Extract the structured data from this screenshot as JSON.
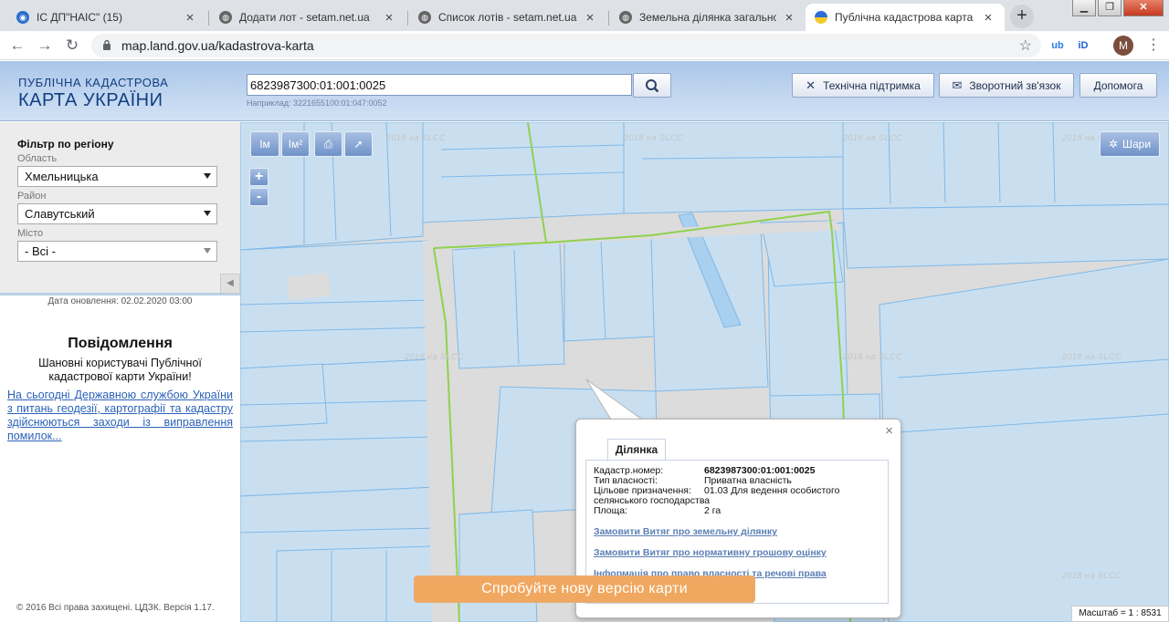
{
  "browser": {
    "tabs": [
      {
        "title": "ІС ДП\"НАІС\" (15)",
        "icon": "globe-blue-icon"
      },
      {
        "title": "Додати лот - setam.net.ua",
        "icon": "globe-icon"
      },
      {
        "title": "Список лотів - setam.net.ua",
        "icon": "globe-icon"
      },
      {
        "title": "Земельна ділянка загальної п",
        "icon": "globe-icon"
      },
      {
        "title": "Публічна кадастрова карта Укр",
        "icon": "ua-flag-icon"
      }
    ],
    "new_tab": "+",
    "url": "map.land.gov.ua/kadastrova-karta",
    "avatar_letter": "M",
    "ext_labels": [
      "ub",
      "iD"
    ]
  },
  "header": {
    "logo_line1": "ПУБЛІЧНА КАДАСТРОВА",
    "logo_line2": "КАРТА УКРАЇНИ",
    "search_value": "6823987300:01:001:0025",
    "search_hint": "Наприклад: 3221655100:01:047:0052",
    "support_label": "Технічна підтримка",
    "feedback_label": "Зворотний зв'язок",
    "help_label": "Допомога"
  },
  "filter": {
    "title": "Фільтр по регіону",
    "region_label": "Область",
    "region_value": "Хмельницька",
    "district_label": "Район",
    "district_value": "Славутський",
    "city_label": "Місто",
    "city_value": "- Всі -"
  },
  "sidebar": {
    "updated": "Дата оновлення: 02.02.2020 03:00",
    "notice_title": "Повідомлення",
    "notice_text": "Шановні користувачі Публічної кадастрової карти України!",
    "notice_link": "На сьогодні Державною службою України з питань геодезії, картографії та кадастру здійснюються заходи із виправлення помилок...",
    "copyright": "© 2016 Всі права захищені. ЦДЗК. Версія 1.17."
  },
  "map": {
    "tools": [
      "Iм",
      "Iм²"
    ],
    "zoom_in": "+",
    "zoom_out": "-",
    "layers_label": "Шари",
    "watermark": "2018 на SLCC",
    "scale": "Масштаб = 1 : 8531",
    "new_version_label": "Спробуйте нову версію карти",
    "parcel_fill": "#c9dff0",
    "parcel_stroke": "#7fb8e8",
    "boundary_color": "#8fd14f"
  },
  "popup": {
    "tab": "Ділянка",
    "close": "×",
    "cadastral_key": "Кадастр.номер:",
    "cadastral_value": "6823987300:01:001:0025",
    "ownership_key": "Тип власності:",
    "ownership_value": "Приватна власність",
    "purpose_key": "Цільове призначення:",
    "purpose_value": "01.03 Для ведення особистого селянського господарства",
    "area_key": "Площа:",
    "area_value": "2 га",
    "link1": "Замовити Витяг про земельну ділянку",
    "link2": "Замовити Витяг про нормативну грошову оцінку",
    "link3": "Інформація про право власності та речові права"
  }
}
